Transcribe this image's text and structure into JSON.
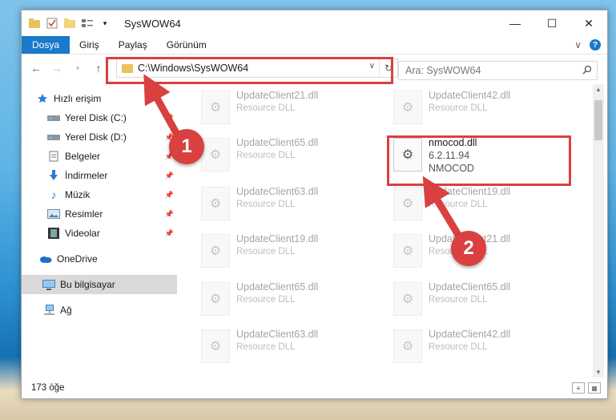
{
  "window": {
    "title": "SysWOW64"
  },
  "ribbon": {
    "tabs": [
      "Dosya",
      "Giriş",
      "Paylaş",
      "Görünüm"
    ]
  },
  "address": {
    "path": "C:\\Windows\\SysWOW64"
  },
  "search": {
    "placeholder": "Ara: SysWOW64"
  },
  "sidebar": {
    "items": [
      {
        "label": "Hızlı erişim",
        "icon": "star-icon"
      },
      {
        "label": "Yerel Disk (C:)",
        "icon": "drive-icon",
        "pinned": true
      },
      {
        "label": "Yerel Disk (D:)",
        "icon": "drive-icon",
        "pinned": true
      },
      {
        "label": "Belgeler",
        "icon": "documents-icon",
        "pinned": true
      },
      {
        "label": "İndirmeler",
        "icon": "download-icon",
        "pinned": true
      },
      {
        "label": "Müzik",
        "icon": "music-icon",
        "pinned": true
      },
      {
        "label": "Resimler",
        "icon": "pictures-icon",
        "pinned": true
      },
      {
        "label": "Videolar",
        "icon": "video-icon",
        "pinned": true
      },
      {
        "label": "OneDrive",
        "icon": "cloud-icon"
      },
      {
        "label": "Bu bilgisayar",
        "icon": "computer-icon",
        "selected": true
      },
      {
        "label": "Ağ",
        "icon": "network-icon"
      }
    ]
  },
  "files": [
    {
      "name": "UpdateClient21.dll",
      "type": "Resource DLL"
    },
    {
      "name": "UpdateClient42.dll",
      "type": "Resource DLL"
    },
    {
      "name": "UpdateClient65.dll",
      "type": "Resource DLL"
    },
    {
      "name": "nmocod.dll",
      "version": "6.2.11.94",
      "type": "NMOCOD",
      "focus": true
    },
    {
      "name": "UpdateClient63.dll",
      "type": "Resource DLL"
    },
    {
      "name": "UpdateClient19.dll",
      "type": "Resource DLL"
    },
    {
      "name": "UpdateClient19.dll",
      "type": "Resource DLL"
    },
    {
      "name": "UpdateClient21.dll",
      "type": "Resource DLL"
    },
    {
      "name": "UpdateClient65.dll",
      "type": "Resource DLL"
    },
    {
      "name": "UpdateClient65.dll",
      "type": "Resource DLL"
    },
    {
      "name": "UpdateClient63.dll",
      "type": "Resource DLL"
    },
    {
      "name": "UpdateClient42.dll",
      "type": "Resource DLL"
    }
  ],
  "status": {
    "count": "173 öğe"
  },
  "annotations": {
    "badge1": "1",
    "badge2": "2",
    "color": "#d9403f"
  }
}
